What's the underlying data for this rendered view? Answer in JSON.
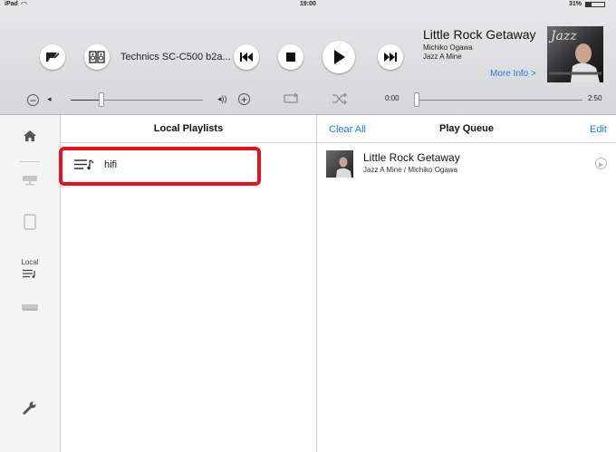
{
  "status_bar": {
    "device": "iPad",
    "time": "19:00",
    "battery": "31%"
  },
  "top_controls": {
    "device_name": "Technics SC-C500 b2a...",
    "time_elapsed": "0:00",
    "time_total": "2:50",
    "volume_level": 0.23,
    "progress_level": 0.0
  },
  "now_playing": {
    "title": "Little Rock Getaway",
    "artist": "Michiko Ogawa",
    "album": "Jazz A Mine",
    "more_info": "More Info >",
    "cover_text": "Jazz"
  },
  "sidebar": {
    "local_label": "Local"
  },
  "local_playlists": {
    "title": "Local Playlists",
    "items": [
      {
        "label": "hifi"
      }
    ]
  },
  "play_queue": {
    "clear_label": "Clear All",
    "title": "Play Queue",
    "edit_label": "Edit",
    "items": [
      {
        "title": "Little Rock Getaway",
        "subtitle": "Jazz A Mine / Michiko Ogawa"
      }
    ]
  },
  "colors": {
    "accent": "#1a7cf0",
    "highlight": "#e8121e"
  }
}
